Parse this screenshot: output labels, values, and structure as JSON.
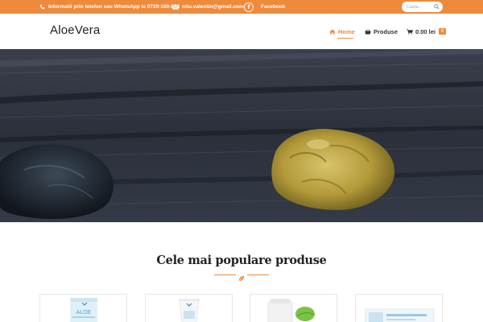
{
  "topbar": {
    "phone_text": "Informatii prin telefon sau WhatsApp la 0720-160-858",
    "email_text": "nitu.valentin@gmail.com",
    "facebook_label": "Facebook",
    "facebook_glyph": "f",
    "search_placeholder": "Cauta..."
  },
  "header": {
    "logo_text": "AloeVera",
    "nav": [
      {
        "label": "Home",
        "icon": "home-icon",
        "active": true
      },
      {
        "label": "Produse",
        "icon": "basket-icon",
        "active": false
      },
      {
        "label": "0.00 lei",
        "icon": "cart-icon",
        "active": false,
        "badge": "0"
      }
    ]
  },
  "section": {
    "title": "Cele mai populare produse"
  },
  "products": [
    {
      "label": "ALOE",
      "icon": "aloe-bottle-product"
    },
    {
      "label": "",
      "icon": "tube-product"
    },
    {
      "label": "",
      "icon": "supplement-jar-product"
    },
    {
      "label": "",
      "icon": "box-product"
    }
  ],
  "colors": {
    "accent": "#ee8a3c",
    "text_dark": "#222222",
    "hero_wood": "#2f3440"
  }
}
